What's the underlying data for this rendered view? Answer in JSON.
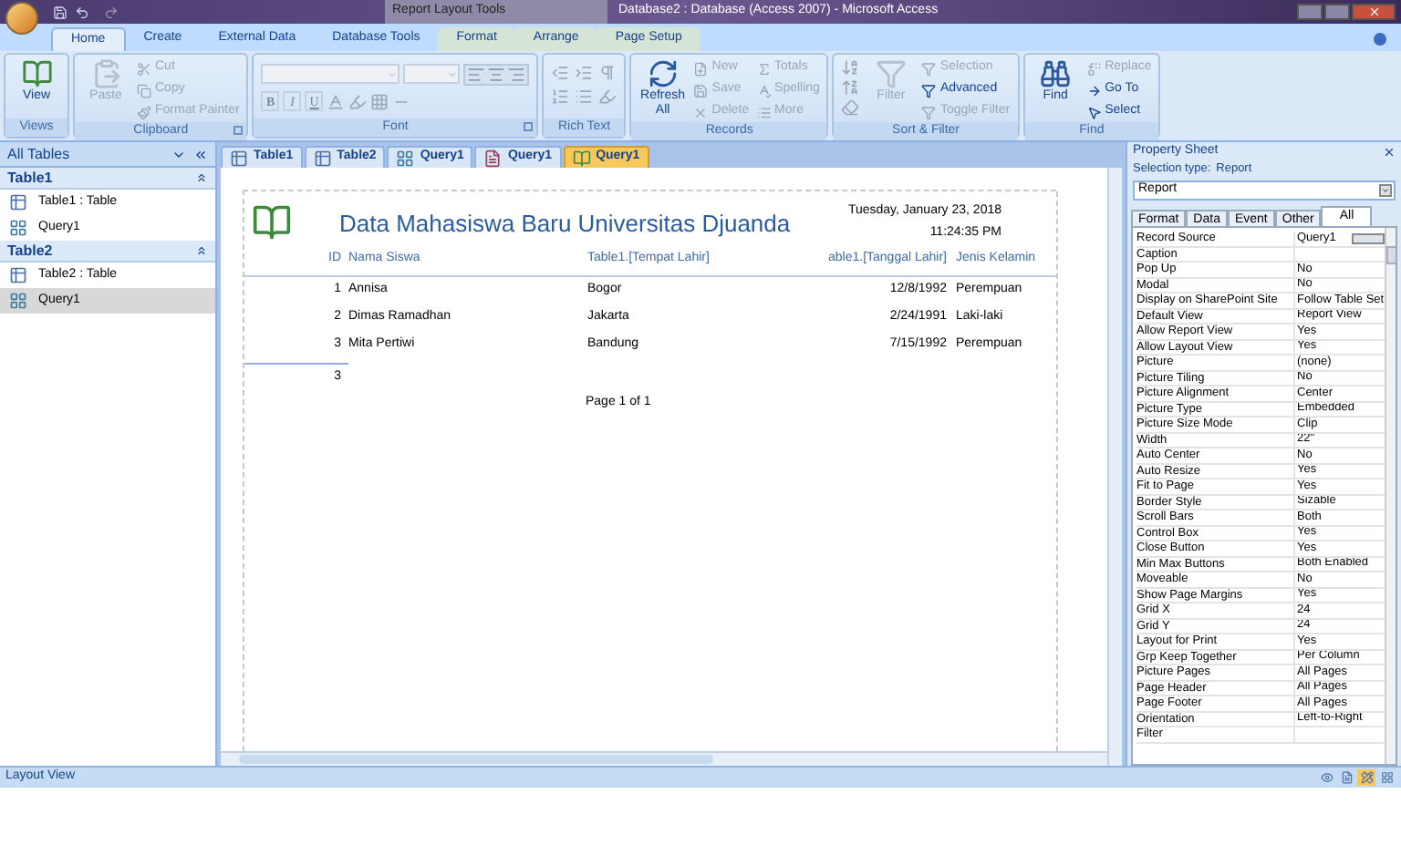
{
  "window": {
    "context_title": "Report Layout Tools",
    "title": "Database2 : Database (Access 2007) - Microsoft Access"
  },
  "ribbon_tabs": [
    {
      "label": "Home",
      "selected": true,
      "kind": "main"
    },
    {
      "label": "Create",
      "selected": false,
      "kind": "main"
    },
    {
      "label": "External Data",
      "selected": false,
      "kind": "main"
    },
    {
      "label": "Database Tools",
      "selected": false,
      "kind": "main"
    },
    {
      "label": "Format",
      "selected": false,
      "kind": "context"
    },
    {
      "label": "Arrange",
      "selected": false,
      "kind": "context"
    },
    {
      "label": "Page Setup",
      "selected": false,
      "kind": "context"
    }
  ],
  "ribbon_groups": [
    {
      "label": "Views",
      "launcher": false,
      "items": [
        {
          "kind": "large",
          "label": "View",
          "disabled": false
        }
      ]
    },
    {
      "label": "Clipboard",
      "launcher": true,
      "items": [
        {
          "kind": "large",
          "label": "Paste",
          "disabled": true
        },
        {
          "kind": "small",
          "label": "Cut",
          "disabled": true
        },
        {
          "kind": "small",
          "label": "Copy",
          "disabled": true
        },
        {
          "kind": "small",
          "label": "Format Painter",
          "disabled": true
        }
      ]
    },
    {
      "label": "Font",
      "launcher": true,
      "items": [
        {
          "kind": "font",
          "letters": [
            "B",
            "I",
            "U"
          ]
        }
      ]
    },
    {
      "label": "Rich Text",
      "launcher": false,
      "items": [
        {
          "kind": "richtext"
        }
      ]
    },
    {
      "label": "Records",
      "launcher": false,
      "items": [
        {
          "kind": "large",
          "label": "Refresh All",
          "disabled": false
        },
        {
          "kind": "small",
          "label": "New",
          "disabled": true
        },
        {
          "kind": "small",
          "label": "Save",
          "disabled": true
        },
        {
          "kind": "small",
          "label": "Delete",
          "disabled": true
        },
        {
          "kind": "small",
          "label": "Totals",
          "disabled": true
        },
        {
          "kind": "small",
          "label": "Spelling",
          "disabled": true
        },
        {
          "kind": "small",
          "label": "More",
          "disabled": true
        }
      ]
    },
    {
      "label": "Sort & Filter",
      "launcher": false,
      "items": [
        {
          "kind": "sort"
        },
        {
          "kind": "large",
          "label": "Filter",
          "disabled": true
        },
        {
          "kind": "small",
          "label": "Selection",
          "disabled": true
        },
        {
          "kind": "small",
          "label": "Advanced",
          "disabled": false
        },
        {
          "kind": "small",
          "label": "Toggle Filter",
          "disabled": true
        }
      ]
    },
    {
      "label": "Find",
      "launcher": false,
      "items": [
        {
          "kind": "large",
          "label": "Find",
          "disabled": false
        },
        {
          "kind": "small",
          "label": "Replace",
          "disabled": true
        },
        {
          "kind": "small",
          "label": "Go To",
          "disabled": false
        },
        {
          "kind": "small",
          "label": "Select",
          "disabled": false
        }
      ]
    }
  ],
  "navigation": {
    "title": "All Tables",
    "groups": [
      {
        "label": "Table1",
        "items": [
          {
            "label": "Table1 : Table",
            "kind": "table",
            "selected": false
          },
          {
            "label": "Query1",
            "kind": "query",
            "selected": false
          }
        ]
      },
      {
        "label": "Table2",
        "items": [
          {
            "label": "Table2 : Table",
            "kind": "table",
            "selected": false
          },
          {
            "label": "Query1",
            "kind": "query",
            "selected": true
          }
        ]
      }
    ]
  },
  "document_tabs": [
    {
      "label": "Table1",
      "kind": "table",
      "selected": false
    },
    {
      "label": "Table2",
      "kind": "table",
      "selected": false
    },
    {
      "label": "Query1",
      "kind": "query",
      "selected": false
    },
    {
      "label": "Query1",
      "kind": "form",
      "selected": false
    },
    {
      "label": "Query1",
      "kind": "report",
      "selected": true
    }
  ],
  "report": {
    "title": "Data Mahasiswa Baru Universitas Djuanda",
    "date": "Tuesday, January 23, 2018",
    "time": "11:24:35 PM",
    "columns": [
      "ID",
      "Nama Siswa",
      "Table1.[Tempat Lahir]",
      "able1.[Tanggal Lahir]",
      "Jenis Kelamin"
    ],
    "rows": [
      [
        "1",
        "Annisa",
        "Bogor",
        "12/8/1992",
        "Perempuan"
      ],
      [
        "2",
        "Dimas Ramadhan",
        "Jakarta",
        "2/24/1991",
        "Laki-laki"
      ],
      [
        "3",
        "Mita Pertiwi",
        "Bandung",
        "7/15/1992",
        "Perempuan"
      ]
    ],
    "count": "3",
    "page": "Page 1 of 1"
  },
  "property_sheet": {
    "title": "Property Sheet",
    "selection_type_label": "Selection type:",
    "selection_type": "Report",
    "object": "Report",
    "tabs": [
      {
        "label": "Format",
        "selected": false
      },
      {
        "label": "Data",
        "selected": false
      },
      {
        "label": "Event",
        "selected": false
      },
      {
        "label": "Other",
        "selected": false
      },
      {
        "label": "All",
        "selected": true
      }
    ],
    "properties": [
      [
        "Record Source",
        "Query1"
      ],
      [
        "Caption"
      ],
      [
        "Pop Up",
        "No"
      ],
      [
        "Modal",
        "No"
      ],
      [
        "Display on SharePoint Site",
        "Follow Table Set"
      ],
      [
        "Default View",
        "Report View"
      ],
      [
        "Allow Report View",
        "Yes"
      ],
      [
        "Allow Layout View",
        "Yes"
      ],
      [
        "Picture",
        "(none)"
      ],
      [
        "Picture Tiling",
        "No"
      ],
      [
        "Picture Alignment",
        "Center"
      ],
      [
        "Picture Type",
        "Embedded"
      ],
      [
        "Picture Size Mode",
        "Clip"
      ],
      [
        "Width",
        "22\""
      ],
      [
        "Auto Center",
        "No"
      ],
      [
        "Auto Resize",
        "Yes"
      ],
      [
        "Fit to Page",
        "Yes"
      ],
      [
        "Border Style",
        "Sizable"
      ],
      [
        "Scroll Bars",
        "Both"
      ],
      [
        "Control Box",
        "Yes"
      ],
      [
        "Close Button",
        "Yes"
      ],
      [
        "Min Max Buttons",
        "Both Enabled"
      ],
      [
        "Moveable",
        "No"
      ],
      [
        "Show Page Margins",
        "Yes"
      ],
      [
        "Grid X",
        "24"
      ],
      [
        "Grid Y",
        "24"
      ],
      [
        "Layout for Print",
        "Yes"
      ],
      [
        "Grp Keep Together",
        "Per Column"
      ],
      [
        "Picture Pages",
        "All Pages"
      ],
      [
        "Page Header",
        "All Pages"
      ],
      [
        "Page Footer",
        "All Pages"
      ],
      [
        "Orientation",
        "Left-to-Right"
      ],
      [
        "Filter"
      ]
    ]
  },
  "status_bar": {
    "text": "Layout View",
    "views": [
      {
        "selected": false
      },
      {
        "selected": false
      },
      {
        "selected": true
      },
      {
        "selected": false
      }
    ]
  }
}
